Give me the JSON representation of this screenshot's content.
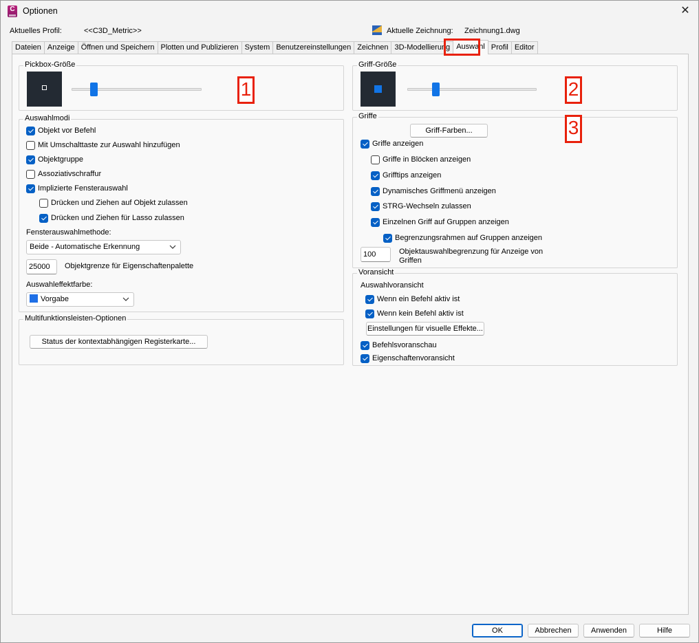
{
  "window": {
    "title": "Optionen",
    "close_label": "✕"
  },
  "header": {
    "profile_label": "Aktuelles Profil:",
    "profile_value": "<<C3D_Metric>>",
    "drawing_label": "Aktuelle Zeichnung:",
    "drawing_value": "Zeichnung1.dwg"
  },
  "tabs": [
    {
      "label": "Dateien"
    },
    {
      "label": "Anzeige"
    },
    {
      "label": "Öffnen und Speichern"
    },
    {
      "label": "Plotten und Publizieren"
    },
    {
      "label": "System"
    },
    {
      "label": "Benutzereinstellungen"
    },
    {
      "label": "Zeichnen"
    },
    {
      "label": "3D-Modellierung"
    },
    {
      "label": "Auswahl"
    },
    {
      "label": "Profil"
    },
    {
      "label": "Editor"
    }
  ],
  "active_tab": "Auswahl",
  "markers": [
    "1",
    "2",
    "3"
  ],
  "pickbox": {
    "title": "Pickbox-Größe",
    "slider_level": 0.17
  },
  "grip_size": {
    "title": "Griff-Größe",
    "slider_level": 0.22
  },
  "selection_modes": {
    "title": "Auswahlmodi",
    "items": [
      {
        "label": "Objekt vor Befehl",
        "checked": true
      },
      {
        "label": "Mit Umschalttaste zur Auswahl hinzufügen",
        "checked": false
      },
      {
        "label": "Objektgruppe",
        "checked": true
      },
      {
        "label": "Assoziativschraffur",
        "checked": false
      },
      {
        "label": "Implizierte Fensterauswahl",
        "checked": true
      },
      {
        "label": "Drücken und Ziehen auf Objekt zulassen",
        "checked": false
      },
      {
        "label": "Drücken und Ziehen für Lasso zulassen",
        "checked": true
      }
    ],
    "window_method_label": "Fensterauswahlmethode:",
    "window_method_value": "Beide - Automatische Erkennung",
    "object_limit_value": "25000",
    "object_limit_label": "Objektgrenze für Eigenschaftenpalette",
    "effect_color_label": "Auswahleffektfarbe:",
    "effect_color_value": "Vorgabe",
    "effect_color_hex": "#1e6fe6"
  },
  "ribbon": {
    "title": "Multifunktionsleisten-Optionen",
    "button_label": "Status der kontextabhängigen Registerkarte..."
  },
  "grips": {
    "title": "Griffe",
    "colors_button": "Griff-Farben...",
    "items": [
      {
        "label": "Griffe anzeigen",
        "checked": true
      },
      {
        "label": "Griffe in Blöcken anzeigen",
        "checked": false
      },
      {
        "label": "Grifftips anzeigen",
        "checked": true
      },
      {
        "label": "Dynamisches Griffmenü anzeigen",
        "checked": true
      },
      {
        "label": "STRG-Wechseln zulassen",
        "checked": true
      },
      {
        "label": "Einzelnen Griff auf Gruppen anzeigen",
        "checked": true
      },
      {
        "label": "Begrenzungsrahmen auf Gruppen anzeigen",
        "checked": true
      }
    ],
    "limit_value": "100",
    "limit_label_line1": "Objektauswahlbegrenzung für Anzeige von",
    "limit_label_line2": "Griffen"
  },
  "preview": {
    "title": "Voransicht",
    "subtitle": "Auswahlvoransicht",
    "items": [
      {
        "label": "Wenn ein Befehl aktiv ist",
        "checked": true
      },
      {
        "label": "Wenn kein Befehl aktiv ist",
        "checked": true
      },
      {
        "label": "Befehlsvoranschau",
        "checked": true
      },
      {
        "label": "Eigenschaftenvoransicht",
        "checked": true
      }
    ],
    "visual_effects_button": "Einstellungen für visuelle Effekte..."
  },
  "footer": {
    "ok": "OK",
    "cancel": "Abbrechen",
    "apply": "Anwenden",
    "help": "Hilfe"
  },
  "colors": {
    "accent": "#0560c5",
    "highlight": "#e8210c",
    "preview_bg": "#232a33"
  }
}
